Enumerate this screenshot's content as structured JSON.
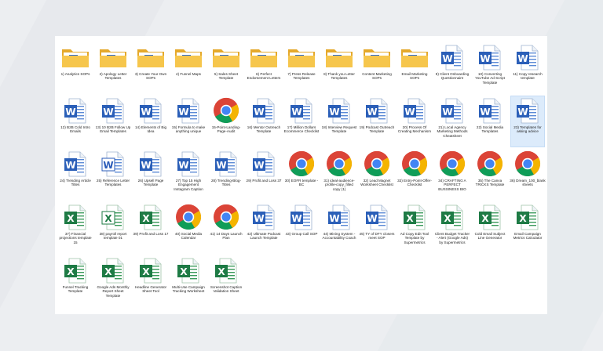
{
  "files": [
    {
      "label": "1) Analytics SOPs",
      "type": "folder"
    },
    {
      "label": "2) Apology Letter Templates",
      "type": "folder"
    },
    {
      "label": "3) Create Your Own SOPs",
      "type": "folder"
    },
    {
      "label": "4) Funnel Maps",
      "type": "folder"
    },
    {
      "label": "5) Sales Sheet Template",
      "type": "folder"
    },
    {
      "label": "6) Perfect Endorsement Letters",
      "type": "folder"
    },
    {
      "label": "7) Press Release Templates",
      "type": "folder"
    },
    {
      "label": "8) Thank you Letter Templates",
      "type": "folder"
    },
    {
      "label": "Content Marketing SOPs",
      "type": "folder"
    },
    {
      "label": "Email Marketing SOPs",
      "type": "folder"
    },
    {
      "label": "9) Client Onboarding Questionnaire",
      "type": "word"
    },
    {
      "label": "10) Converting YouTube Ad Script Template",
      "type": "word"
    },
    {
      "label": "11) Copy research template",
      "type": "word"
    },
    {
      "label": "12) B2B Cold Intro Emails",
      "type": "word"
    },
    {
      "label": "13) 10 B2B Follow Up Email Templates",
      "type": "word"
    },
    {
      "label": "14) Elements of Big Idea",
      "type": "word"
    },
    {
      "label": "15) Formula to make anything unique",
      "type": "word"
    },
    {
      "label": "15-Point-Landing-Page-Audit",
      "type": "chrome"
    },
    {
      "label": "16) Mentor Outreach Template",
      "type": "word"
    },
    {
      "label": "17) Million Dollars Ecommerce Checklist",
      "type": "word"
    },
    {
      "label": "18) Interview Request Template",
      "type": "word"
    },
    {
      "label": "19) Podcast Outreach Template",
      "type": "word"
    },
    {
      "label": "20) Process Of Creating Mechanism",
      "type": "word"
    },
    {
      "label": "21) Local Agency Marketing Methods Cheatsheet",
      "type": "word"
    },
    {
      "label": "22) Social Media Templates",
      "type": "word"
    },
    {
      "label": "23) Templates for asking advice",
      "type": "word",
      "selected": true
    },
    {
      "label": "24) Trending Article Titles",
      "type": "word"
    },
    {
      "label": "25) Reference Letter Templates",
      "type": "word-alt"
    },
    {
      "label": "26) Upsell Page Template",
      "type": "word"
    },
    {
      "label": "27) Top 15 High Engagement Instagram Caption",
      "type": "word"
    },
    {
      "label": "28) Trending-Blog-Titles",
      "type": "word"
    },
    {
      "label": "29) Profit and Loss 37",
      "type": "word"
    },
    {
      "label": "30) EOFR template - BC",
      "type": "chrome"
    },
    {
      "label": "31) ideal-audience-profile-copy_filled copy (1)",
      "type": "chrome"
    },
    {
      "label": "32) Lead Magnet Worksheet Checklist",
      "type": "chrome"
    },
    {
      "label": "33) Entry-Point-Offer-Checklist",
      "type": "chrome"
    },
    {
      "label": "34) CRAFTING A PERFECT BUSSINESS BIO",
      "type": "chrome"
    },
    {
      "label": "35) The Canva TRICKS Template",
      "type": "chrome"
    },
    {
      "label": "36) Dream_100_blank sheets",
      "type": "chrome"
    },
    {
      "label": "37) Financial projections template 15",
      "type": "excel"
    },
    {
      "label": "38) payroll report template 01",
      "type": "excel-alt"
    },
    {
      "label": "39) Profit and Loss 17",
      "type": "excel"
    },
    {
      "label": "40) Social Media Calendar",
      "type": "chrome"
    },
    {
      "label": "41) 14 Days Launch Plan",
      "type": "chrome"
    },
    {
      "label": "42) Ultimate Podcast Launch Template",
      "type": "word"
    },
    {
      "label": "43) Group Call SOP",
      "type": "word"
    },
    {
      "label": "44) Mining System - Accountability Coach",
      "type": "word"
    },
    {
      "label": "45) TY of DFY closers meet SOP",
      "type": "word"
    },
    {
      "label": "Ad Copy Edit Tool Template by Supermetrics",
      "type": "excel"
    },
    {
      "label": "Client Budget Tracker - Alert (Google Ads) by Supermetrics",
      "type": "excel"
    },
    {
      "label": "Cold Email Subject Line Generator",
      "type": "excel"
    },
    {
      "label": "Email Campaign Metrics Calculator",
      "type": "excel"
    },
    {
      "label": "Funnel Tracking Template",
      "type": "excel"
    },
    {
      "label": "Google Ads Monthly Report Sheet Template",
      "type": "excel"
    },
    {
      "label": "Headline Generator Sheet Tool",
      "type": "excel"
    },
    {
      "label": "Multi-Use Campaign Tracking Worksheet",
      "type": "excel"
    },
    {
      "label": "Screenshot Caption Validation Sheet",
      "type": "excel"
    }
  ]
}
